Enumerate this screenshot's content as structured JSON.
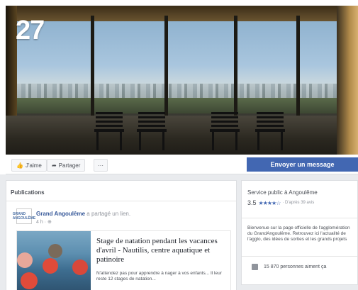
{
  "cover": {
    "badge": "27"
  },
  "actions": {
    "like_label": "J'aime",
    "share_label": "Partager",
    "more_label": "···",
    "message_label": "Envoyer un message"
  },
  "publications": {
    "title": "Publications",
    "post": {
      "author": "Grand Angoulême",
      "verb": "a partagé un lien.",
      "meta": "4 h · ⊕",
      "avatar_text": "GRAND ANGOULÊME",
      "headline": "Stage de natation pendant les vacances d'avril - Nautilis, centre aquatique et patinoire",
      "summary": "N'attendez pas pour apprendre à nager à vos enfants... Il leur reste 12 stages de natation..."
    }
  },
  "sidebar": {
    "category": "Service public à Angoulême",
    "rating": "3.5",
    "stars": "★★★★☆",
    "reviews": "· D'après 39 avis",
    "about": "Bienvenue sur la page officielle de l'agglomération du GrandAngoulême. Retrouvez ici l'actualité de l'agglo, des idées de sorties et les grands projets",
    "likes": "15 870 personnes aiment ça"
  }
}
